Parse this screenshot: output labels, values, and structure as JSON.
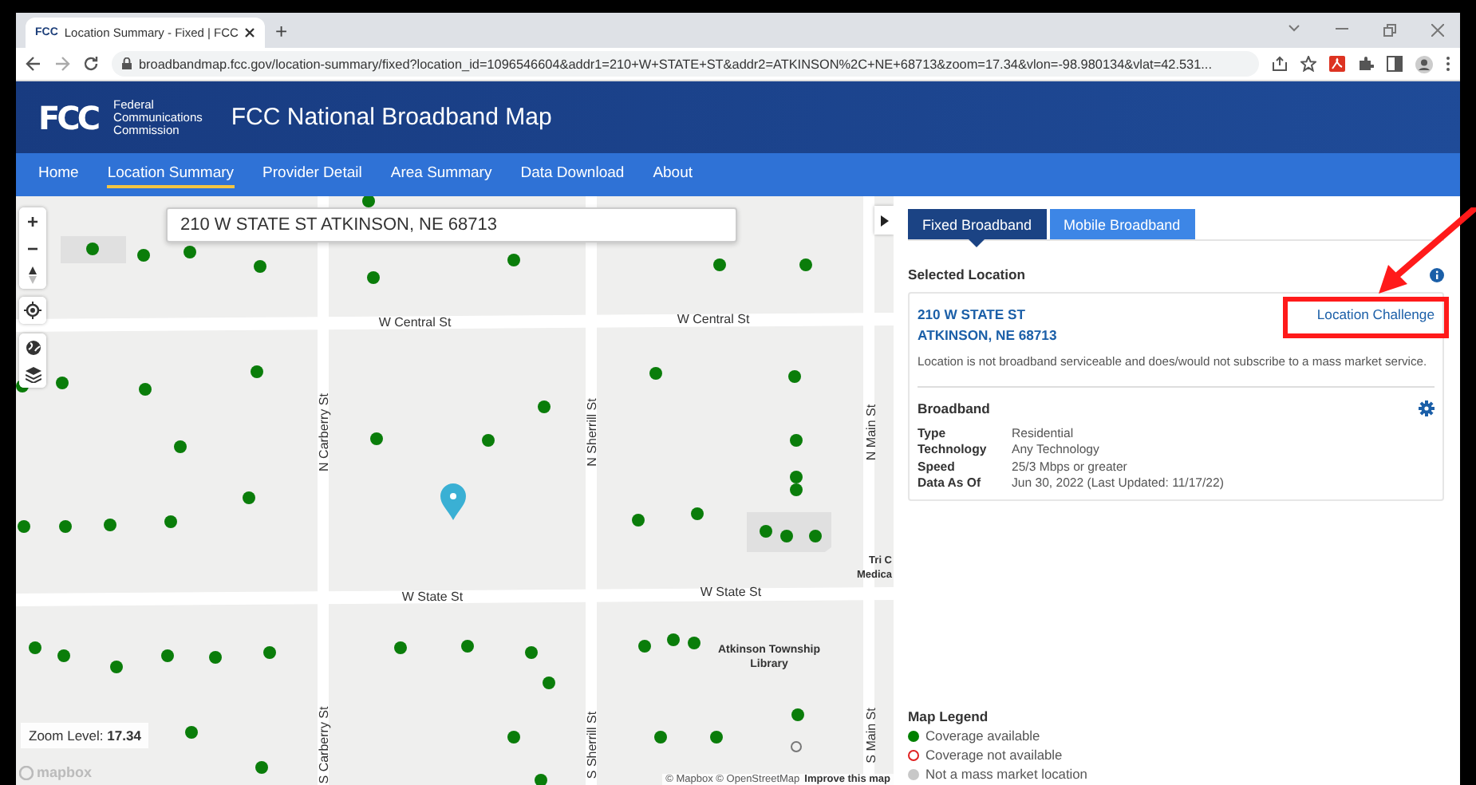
{
  "browser": {
    "favicon": "FCC",
    "tab_title": "Location Summary - Fixed | FCC",
    "new_tab": "+",
    "url": "broadbandmap.fcc.gov/location-summary/fixed?location_id=1096546604&addr1=210+W+STATE+ST&addr2=ATKINSON%2C+NE+68713&zoom=17.34&vlon=-98.980134&vlat=42.531..."
  },
  "header": {
    "logo": "FCC",
    "agency": [
      "Federal",
      "Communications",
      "Commission"
    ],
    "title": "FCC National Broadband Map"
  },
  "nav": [
    {
      "label": "Home",
      "selected": false
    },
    {
      "label": "Location Summary",
      "selected": true
    },
    {
      "label": "Provider Detail",
      "selected": false
    },
    {
      "label": "Area Summary",
      "selected": false
    },
    {
      "label": "Data Download",
      "selected": false
    },
    {
      "label": "About",
      "selected": false
    }
  ],
  "map": {
    "search": {
      "value": "210 W STATE ST ATKINSON, NE 68713"
    },
    "controls": [
      "+",
      "−"
    ],
    "street_labels": [
      {
        "text": "W Central St"
      },
      {
        "text": "W Central St"
      },
      {
        "text": "N Carberry St"
      },
      {
        "text": "N Sherrill St"
      },
      {
        "text": "N Main St"
      },
      {
        "text": "W State St"
      },
      {
        "text": "W State St"
      },
      {
        "text": "S Carberry St"
      },
      {
        "text": "S Sherrill St"
      },
      {
        "text": "S Main St"
      }
    ],
    "place_labels": [
      {
        "lines": [
          "Atkinson Township",
          "Library"
        ]
      },
      {
        "lines": [
          "Tri C",
          "Medica"
        ]
      }
    ],
    "zoom_label": "Zoom Level:",
    "zoom_value": "17.34",
    "logo": "mapbox",
    "attribution": "© Mapbox © OpenStreetMap",
    "improve_link": "Improve this map"
  },
  "sidebar": {
    "tabs": [
      {
        "label": "Fixed Broadband",
        "selected": true
      },
      {
        "label": "Mobile Broadband",
        "selected": false
      }
    ],
    "section_title": "Selected Location",
    "address": [
      "210 W STATE ST",
      "ATKINSON, NE 68713"
    ],
    "challenge_link": "Location Challenge",
    "note": "Location is not broadband serviceable and does/would not subscribe to a mass market service.",
    "broadband_title": "Broadband",
    "details": [
      {
        "label": "Type",
        "value": "Residential"
      },
      {
        "label": "Technology",
        "value": "Any Technology"
      },
      {
        "label": "Speed",
        "value": "25/3 Mbps or greater"
      },
      {
        "label": "Data As Of",
        "value": "Jun 30, 2022 (Last Updated: 11/17/22)"
      }
    ],
    "legend_title": "Map Legend",
    "legend": [
      {
        "label": "Coverage available",
        "kind": "filled",
        "color": "#008000"
      },
      {
        "label": "Coverage not available",
        "kind": "ring",
        "color": "#e02020"
      },
      {
        "label": "Not a mass market location",
        "kind": "filled",
        "color": "#c8c8c8"
      }
    ]
  }
}
